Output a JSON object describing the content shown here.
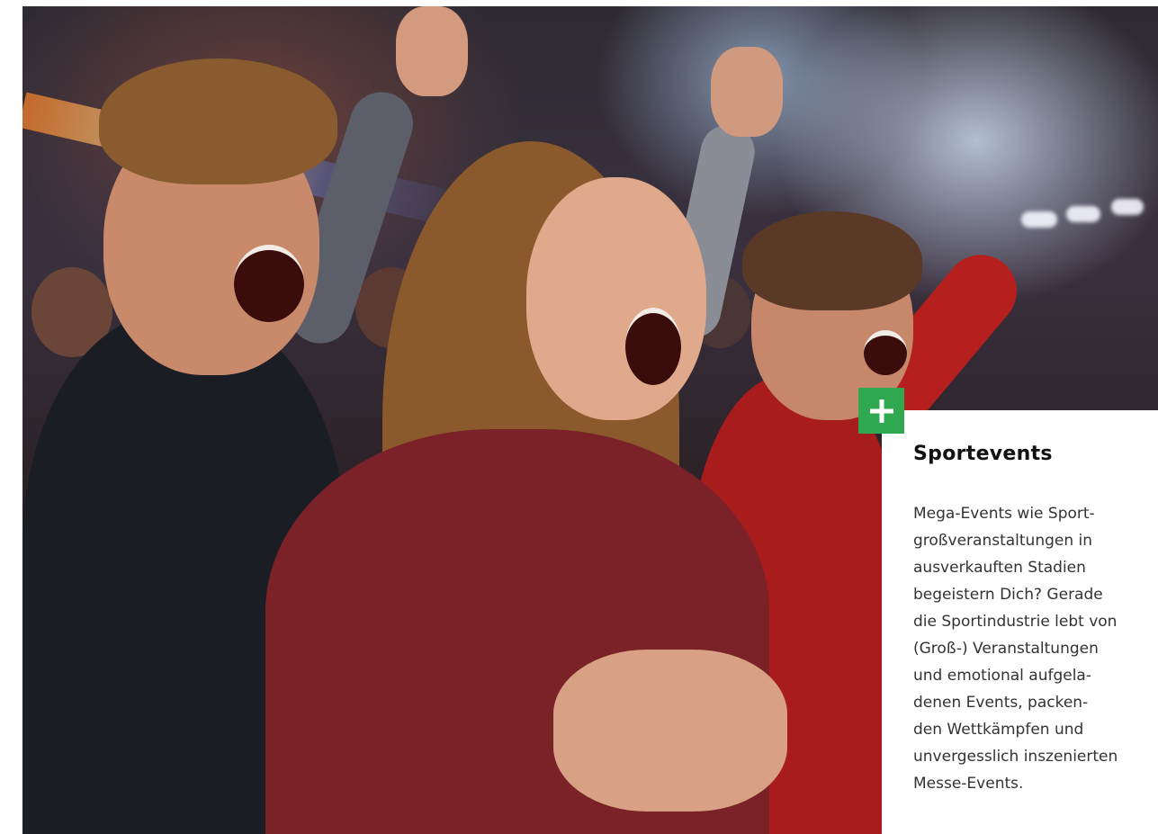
{
  "hero_image": {
    "alt_subject": "crowd-of-cheering-fans"
  },
  "card": {
    "expand_icon": "plus-icon",
    "accent_color": "#2fa84f",
    "title": "Sportevents",
    "text_lines": [
      "Mega-Events wie Sport-",
      "großveranstaltungen in",
      "ausverkauften Stadien",
      "begeistern Dich? Gerade",
      "die Sportindustrie lebt von",
      "(Groß-) Veranstaltungen",
      "und emotional aufgela-",
      "denen Events, packen-",
      "den Wettkämpfen und",
      "unvergesslich inszenierten",
      "Messe-Events."
    ]
  }
}
